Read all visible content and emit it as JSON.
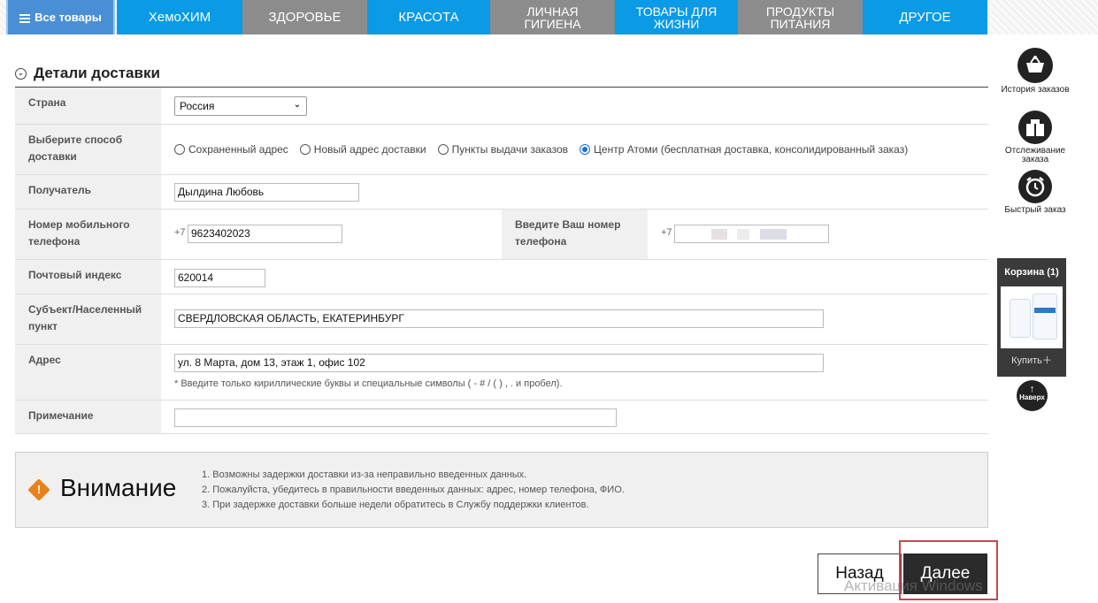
{
  "nav": {
    "all_goods": "Все товары",
    "items": [
      "ХемоХИМ",
      "ЗДОРОВЬЕ",
      "КРАСОТА",
      "ЛИЧНАЯ ГИГИЕНА",
      "ТОВАРЫ ДЛЯ ЖИЗНИ",
      "ПРОДУКТЫ ПИТАНИЯ",
      "ДРУГОЕ"
    ],
    "items_split": [
      [
        "ЛИЧНАЯ",
        "ГИГИЕНА"
      ],
      [
        "ТОВАРЫ ДЛЯ",
        "ЖИЗНИ"
      ],
      [
        "ПРОДУКТЫ",
        "ПИТАНИЯ"
      ]
    ],
    "colors": [
      "#0a9ae6",
      "#8c8c8c",
      "#0a9ae6",
      "#8c8c8c",
      "#0a9ae6",
      "#8c8c8c",
      "#0a9ae6"
    ]
  },
  "section": {
    "title": "Детали доставки"
  },
  "form": {
    "country": {
      "label": "Страна",
      "value": "Россия"
    },
    "delivery": {
      "label": "Выберите способ доставки",
      "options": [
        "Сохраненный адрес",
        "Новый адрес доставки",
        "Пункты выдачи заказов",
        "Центр Атоми (бесплатная доставка, консолидированный заказ)"
      ],
      "selected_index": 3
    },
    "recipient": {
      "label": "Получатель",
      "value": "Дылдина Любовь"
    },
    "mobile": {
      "label": "Номер мобильного телефона",
      "prefix": "+7",
      "value": "9623402023"
    },
    "phone": {
      "label": "Введите Ваш номер телефона",
      "prefix": "+7",
      "value": ""
    },
    "zip": {
      "label": "Почтовый индекс",
      "value": "620014"
    },
    "region": {
      "label": "Субъект/Населенный пункт",
      "value": "СВЕРДЛОВСКАЯ ОБЛАСТЬ, ЕКАТЕРИНБУРГ"
    },
    "address": {
      "label": "Адрес",
      "value": "ул. 8 Марта, дом 13, этаж 1, офис 102",
      "hint": "* Введите только кириллические буквы и специальные символы ( - # / ( ) , . и пробел)."
    },
    "note": {
      "label": "Примечание",
      "value": ""
    }
  },
  "attention": {
    "title": "Внимание",
    "items": [
      "1. Возможны задержки доставки из-за неправильно введенных данных.",
      "2. Пожалуйста, убедитесь в правильности введенных данных: адрес, номер телефона, ФИО.",
      "3. При задержке доставки больше недели обратитесь в Службу поддержки клиентов."
    ]
  },
  "buttons": {
    "back": "Назад",
    "next": "Далее"
  },
  "watermark": "Активация Windows",
  "sidebar": {
    "order_history": "История заказов",
    "tracking": "Отслеживание заказа",
    "quick_order": "Быстрый заказ",
    "cart_title": "Корзина (1)",
    "buy": "Купить＋",
    "to_top": "Наверх"
  }
}
